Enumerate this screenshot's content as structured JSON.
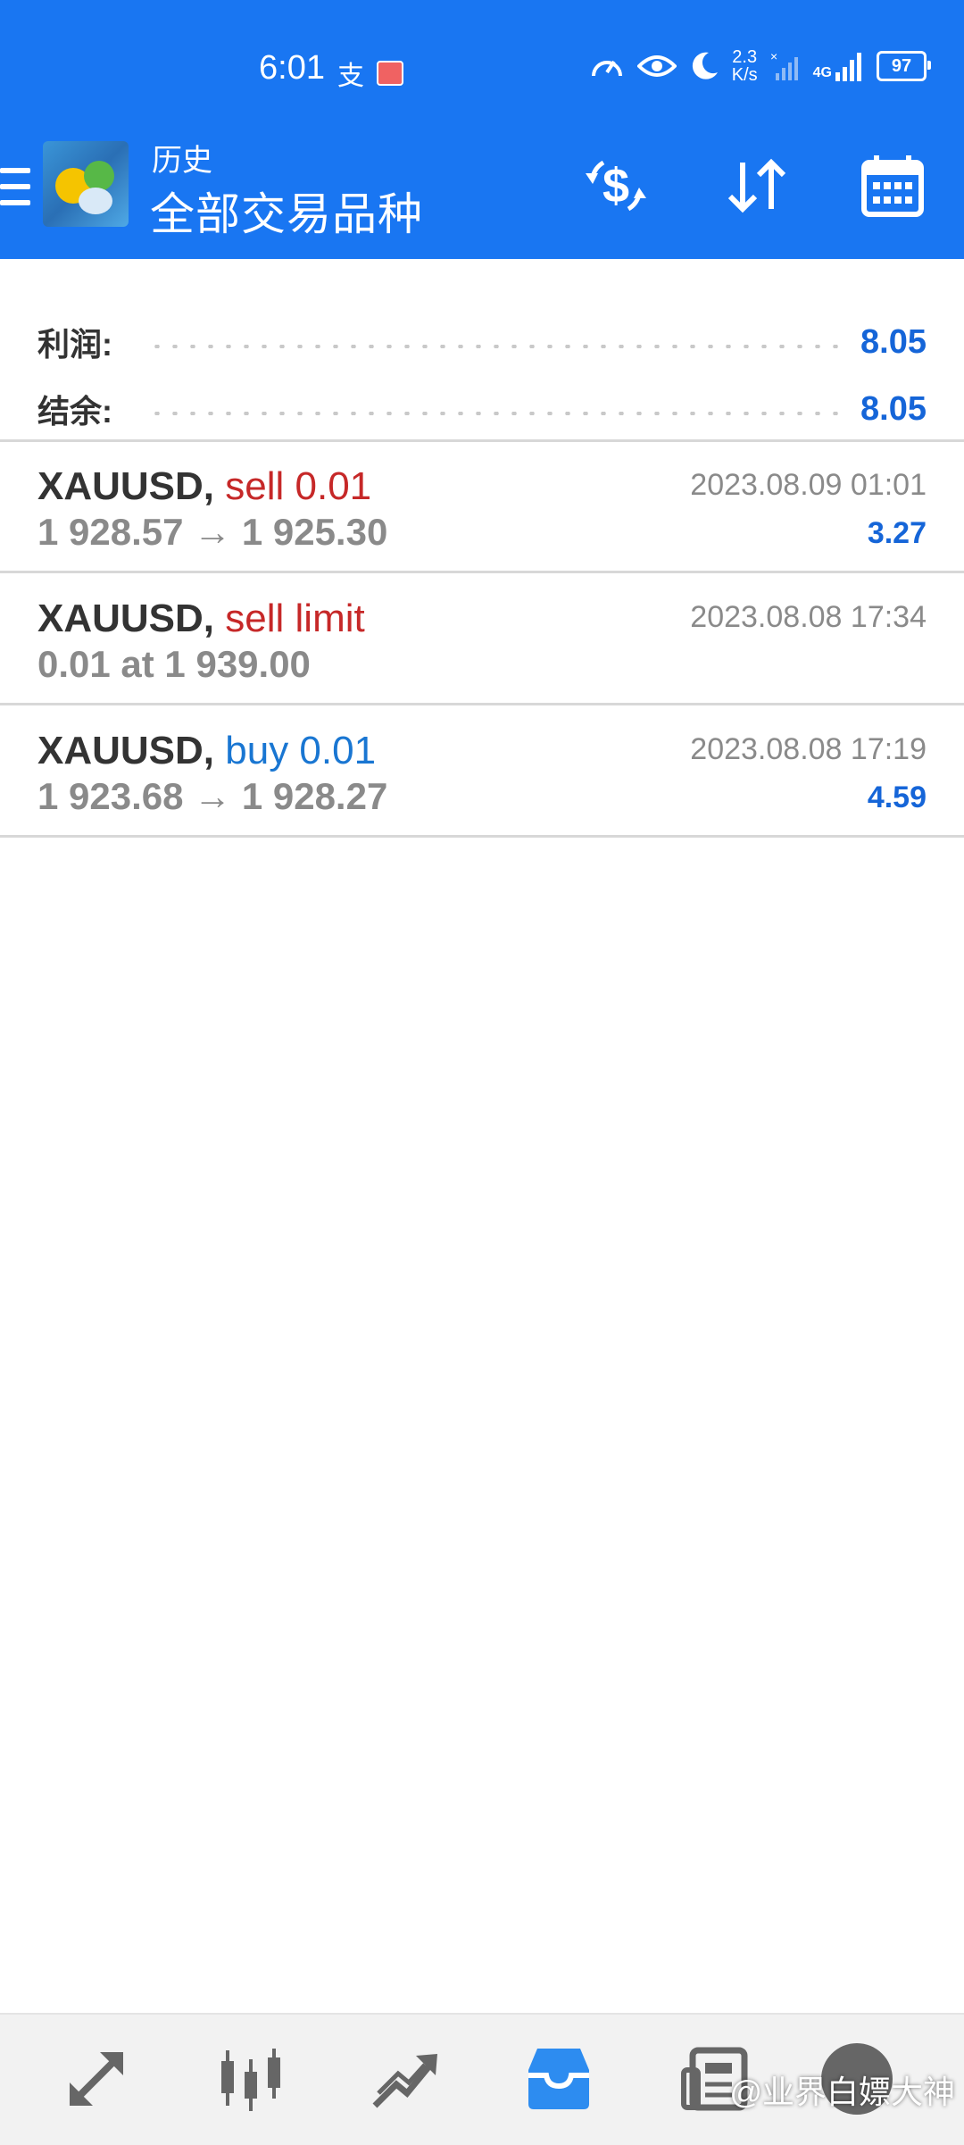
{
  "status_bar": {
    "time": "6:01",
    "speed_top": "2.3",
    "speed_bottom": "K/s",
    "network": "4G",
    "battery": "97"
  },
  "toolbar": {
    "subtitle": "历史",
    "title": "全部交易品种"
  },
  "summary": {
    "profit_label": "利润:",
    "profit_value": "8.05",
    "balance_label": "结余:",
    "balance_value": "8.05"
  },
  "history": [
    {
      "symbol": "XAUUSD,",
      "action": "sell 0.01",
      "action_type": "sell",
      "detail": "1 928.57 → 1 925.30",
      "time": "2023.08.09 01:01",
      "profit": "3.27"
    },
    {
      "symbol": "XAUUSD,",
      "action": "sell limit",
      "action_type": "sell",
      "detail": "0.01 at 1 939.00",
      "time": "2023.08.08 17:34",
      "profit": ""
    },
    {
      "symbol": "XAUUSD,",
      "action": "buy 0.01",
      "action_type": "buy",
      "detail": "1 923.68 → 1 928.27",
      "time": "2023.08.08 17:19",
      "profit": "4.59"
    }
  ],
  "bottom_nav": {
    "items": [
      "quotes-icon",
      "chart-icon",
      "trade-icon",
      "history-icon",
      "news-icon",
      "chat-icon"
    ],
    "active_index": 3
  },
  "watermark": "@业界白嫖大神",
  "colors": {
    "header_bg": "#1976f2",
    "sell": "#c62828",
    "buy": "#1976d2",
    "profit": "#1565d8"
  }
}
